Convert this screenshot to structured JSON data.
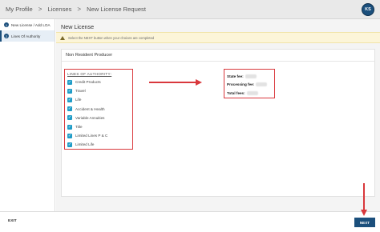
{
  "breadcrumb": {
    "items": [
      "My Profile",
      "Licenses",
      "New License Request"
    ],
    "separator": ">"
  },
  "user": {
    "initials": "KS"
  },
  "sidebar": {
    "steps": [
      {
        "number": "1",
        "label": "New License / Add LOA"
      },
      {
        "number": "2",
        "label": "Lines Of Authority"
      }
    ]
  },
  "main": {
    "title": "New License",
    "notice": "Select the NEXT button when your choices are completed",
    "card_title": "Non Resident Producer",
    "loa_heading": "LINES OF AUTHORITY:",
    "loa_items": [
      "Credit Products",
      "Travel",
      "Life",
      "Accident & Health",
      "Variable Annuities",
      "Title",
      "Limited Lines P & C",
      "Limited Life"
    ],
    "fees": {
      "state_label": "State fee:",
      "processing_label": "Processing fee:",
      "total_label": "Total fees:"
    }
  },
  "footer": {
    "exit_label": "EXIT",
    "next_label": "NEXT"
  },
  "colors": {
    "brand": "#1b4f7c",
    "annotation": "#d9383c",
    "checkbox": "#1f9cc7",
    "notice_bg": "#fcf5d8"
  }
}
